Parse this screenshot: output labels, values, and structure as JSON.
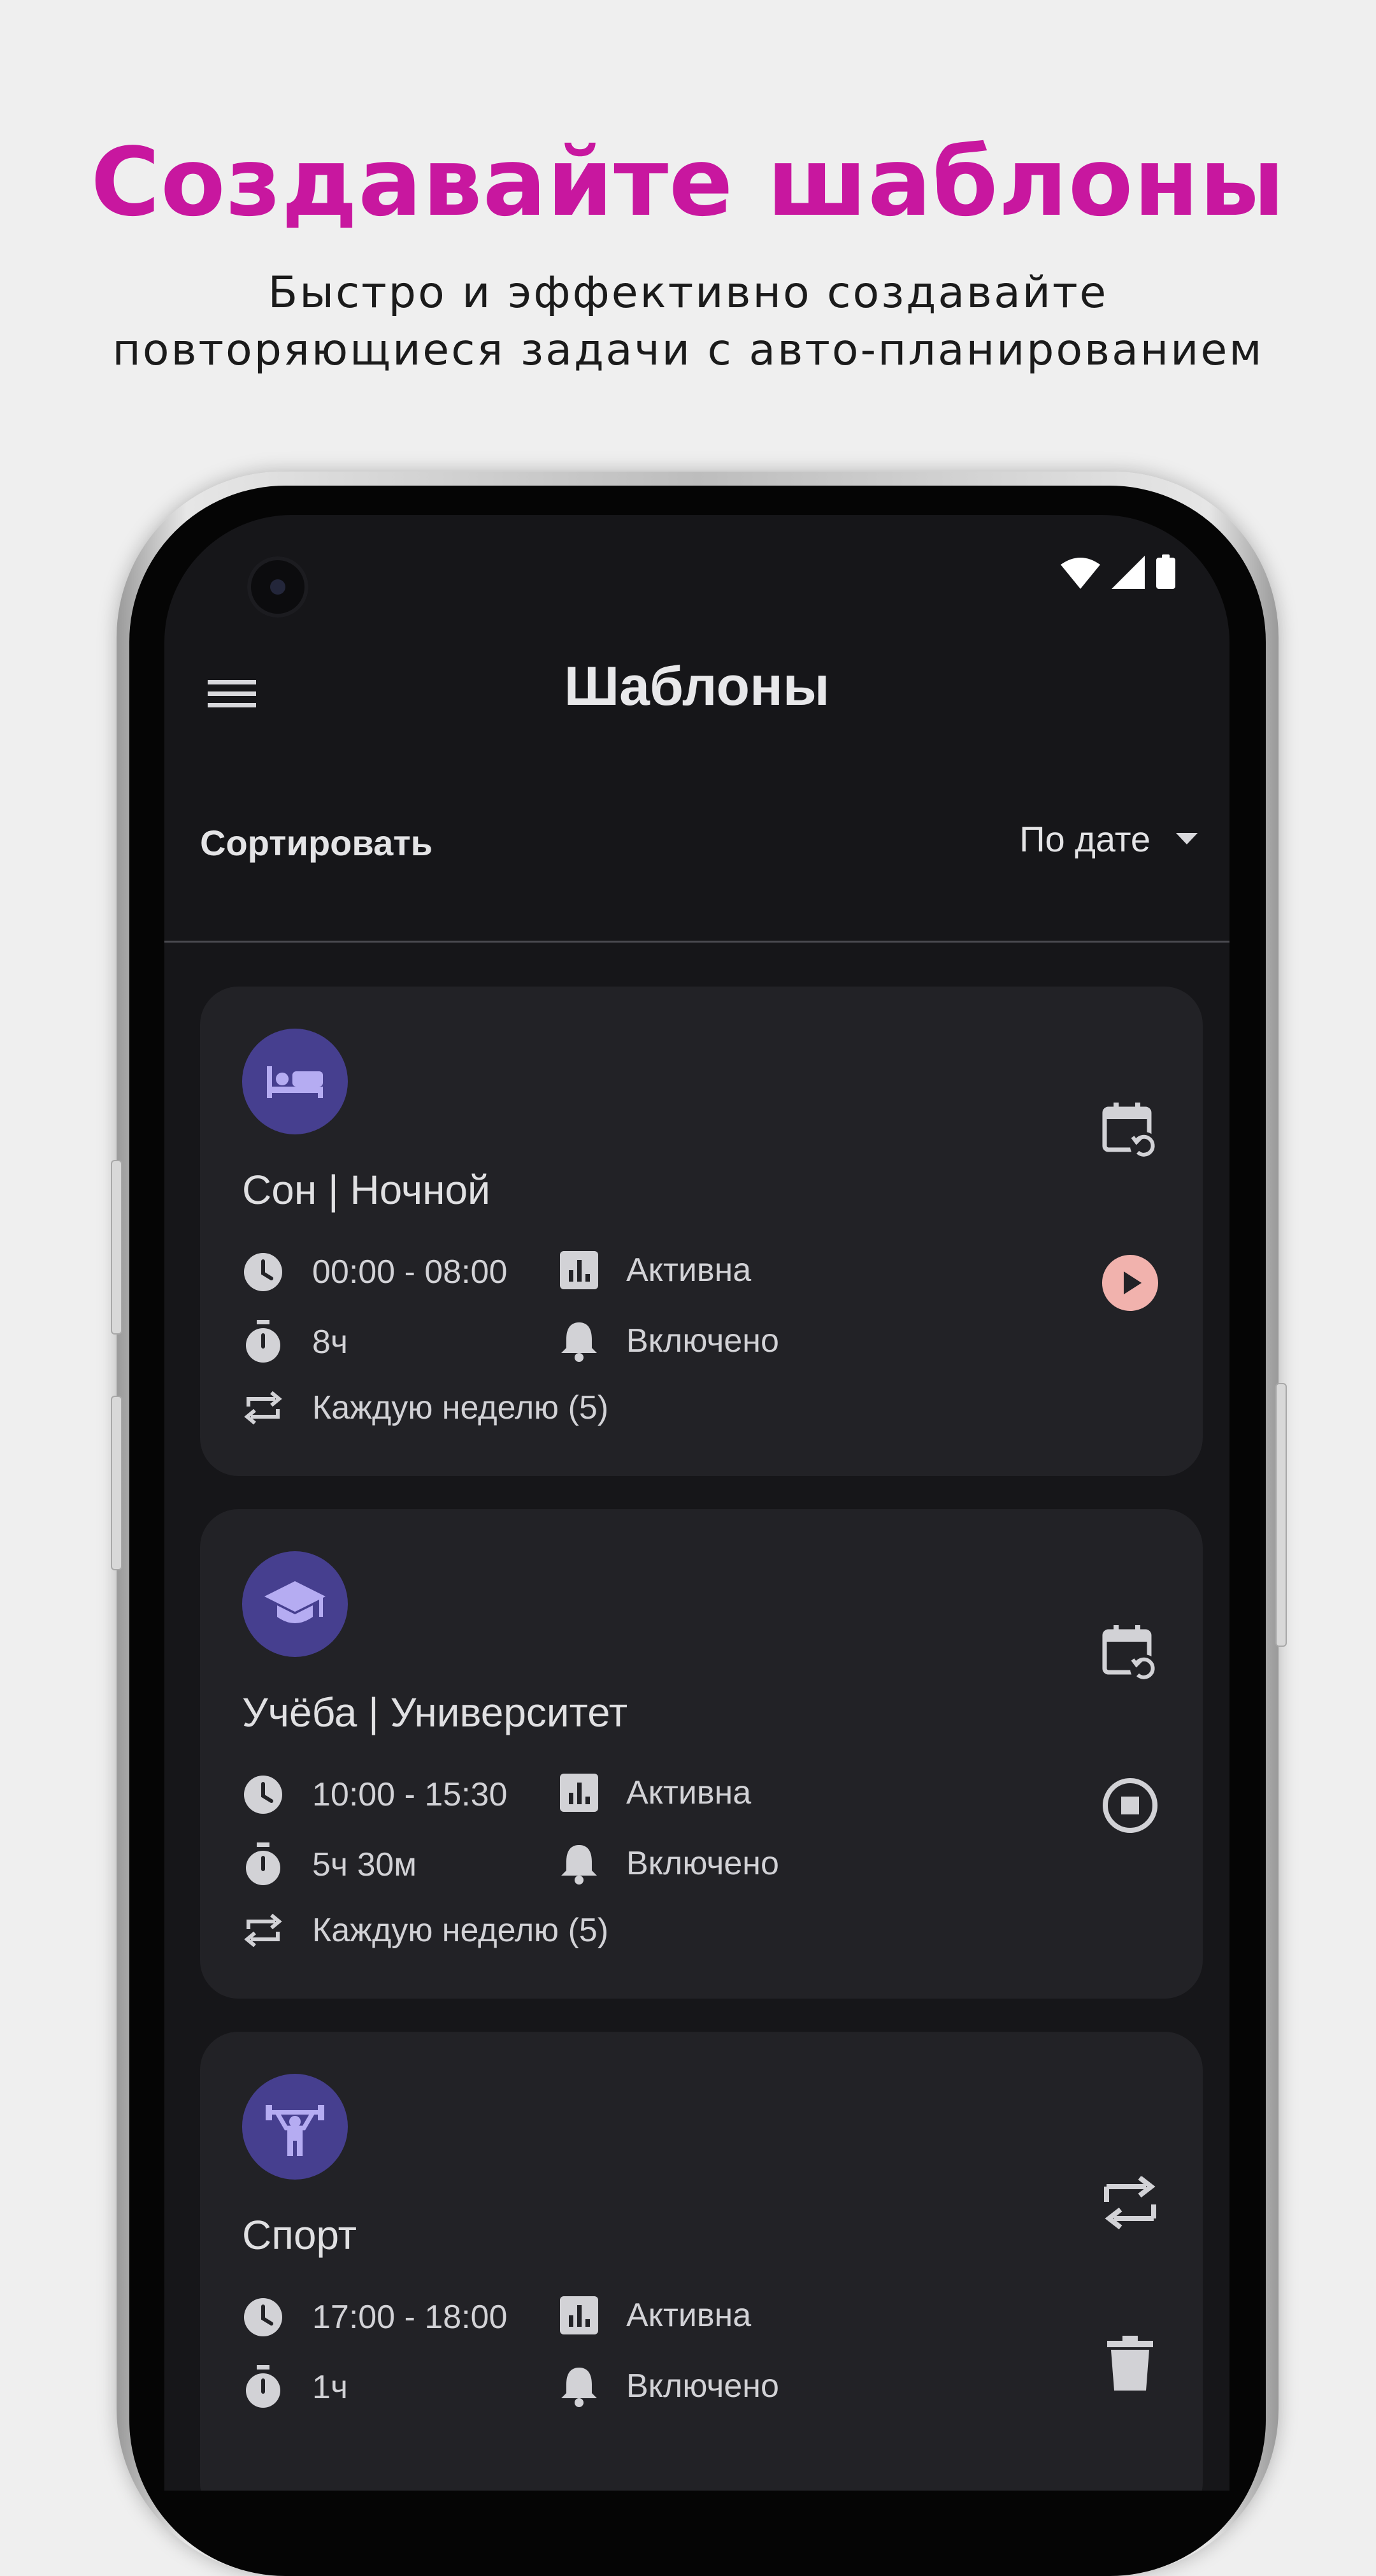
{
  "promo": {
    "title": "Создавайте шаблоны",
    "subtitle_line1": "Быстро и эффективно создавайте",
    "subtitle_line2": "повторяющиеся задачи с авто-планированием",
    "accent_color": "#c8179f"
  },
  "app_bar": {
    "title": "Шаблоны",
    "menu_icon": "hamburger-menu-icon"
  },
  "sort": {
    "label": "Сортировать",
    "value": "По дате"
  },
  "templates": [
    {
      "title": "Сон | Ночной",
      "icon": "bed-icon",
      "time_range": "00:00 - 08:00",
      "duration": "8ч",
      "status": "Активна",
      "notifications": "Включено",
      "repeat": "Каждую неделю (5)",
      "actions": [
        "calendar-reschedule-icon",
        "play-icon"
      ]
    },
    {
      "title": "Учёба | Университет",
      "icon": "graduation-cap-icon",
      "time_range": "10:00 - 15:30",
      "duration": "5ч 30м",
      "status": "Активна",
      "notifications": "Включено",
      "repeat": "Каждую неделю (5)",
      "actions": [
        "calendar-reschedule-icon",
        "stop-icon"
      ]
    },
    {
      "title": "Спорт",
      "icon": "weightlifter-icon",
      "time_range": "17:00 - 18:00",
      "duration": "1ч",
      "status": "Активна",
      "notifications": "Включено",
      "actions": [
        "repeat-icon",
        "trash-icon"
      ]
    }
  ],
  "colors": {
    "screen_bg": "#161619",
    "card_bg": "#222226",
    "avatar_bg": "#463f8f",
    "avatar_icon": "#b5acf2",
    "play_button": "#f1b2ad"
  }
}
